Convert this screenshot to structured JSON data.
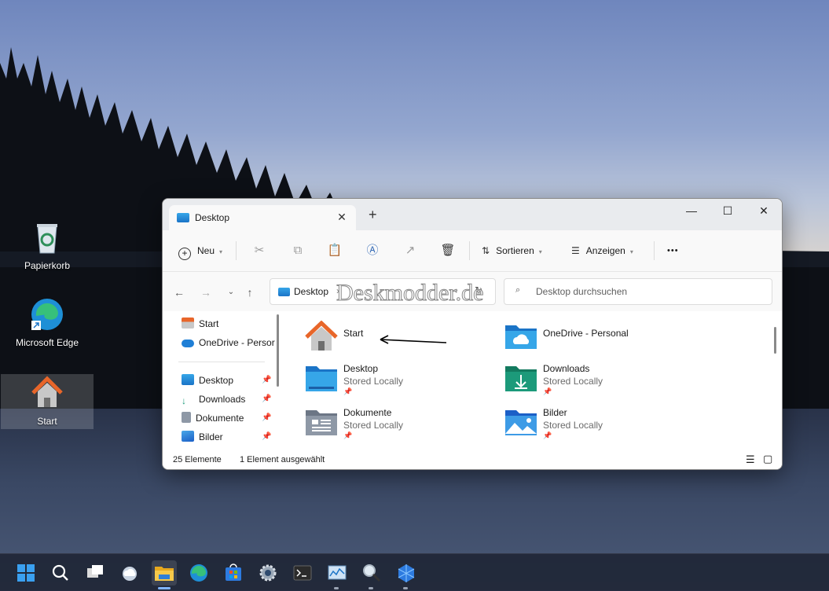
{
  "desktop": {
    "icons": [
      {
        "label": "Papierkorb",
        "icon": "recycle-bin-icon"
      },
      {
        "label": "Microsoft Edge",
        "icon": "edge-icon"
      },
      {
        "label": "Start",
        "icon": "home-icon"
      }
    ]
  },
  "window": {
    "tab_title": "Desktop",
    "tab_close": "✕",
    "new_tab": "+",
    "minimize": "—",
    "maximize": "☐",
    "close": "✕"
  },
  "toolbar": {
    "new_label": "Neu",
    "sort_label": "Sortieren",
    "view_label": "Anzeigen",
    "more": "•••"
  },
  "address": {
    "path": "Desktop",
    "search_placeholder": "Desktop durchsuchen"
  },
  "sidebar": {
    "items": [
      {
        "label": "Start",
        "icon": "home-icon",
        "pinned": false
      },
      {
        "label": "OneDrive - Persor",
        "icon": "onedrive-icon",
        "pinned": false
      },
      {
        "label": "Desktop",
        "icon": "desktop-folder-icon",
        "pinned": true
      },
      {
        "label": "Downloads",
        "icon": "download-icon",
        "pinned": true
      },
      {
        "label": "Dokumente",
        "icon": "document-icon",
        "pinned": true
      },
      {
        "label": "Bilder",
        "icon": "pictures-icon",
        "pinned": true
      }
    ]
  },
  "content": {
    "items": [
      {
        "name": "Start",
        "sub": "",
        "icon": "home-icon"
      },
      {
        "name": "OneDrive - Personal",
        "sub": "",
        "icon": "onedrive-folder-icon"
      },
      {
        "name": "Desktop",
        "sub": "Stored Locally",
        "icon": "desktop-folder-icon"
      },
      {
        "name": "Downloads",
        "sub": "Stored Locally",
        "icon": "downloads-folder-icon"
      },
      {
        "name": "Dokumente",
        "sub": "Stored Locally",
        "icon": "documents-folder-icon"
      },
      {
        "name": "Bilder",
        "sub": "Stored Locally",
        "icon": "pictures-folder-icon"
      }
    ]
  },
  "status": {
    "count": "25 Elemente",
    "selected": "1 Element ausgewählt"
  },
  "watermark": "Deskmodder.de",
  "taskbar": {
    "apps": [
      "start-icon",
      "search-icon",
      "task-view-icon",
      "widgets-icon",
      "file-explorer-icon",
      "edge-icon",
      "store-icon",
      "settings-icon",
      "terminal-icon",
      "resource-monitor-icon",
      "magnifier-icon",
      "app-icon"
    ]
  },
  "colors": {
    "accent": "#0067c0",
    "folder_blue": "#1b74c7",
    "folder_green": "#1c9a7a"
  }
}
